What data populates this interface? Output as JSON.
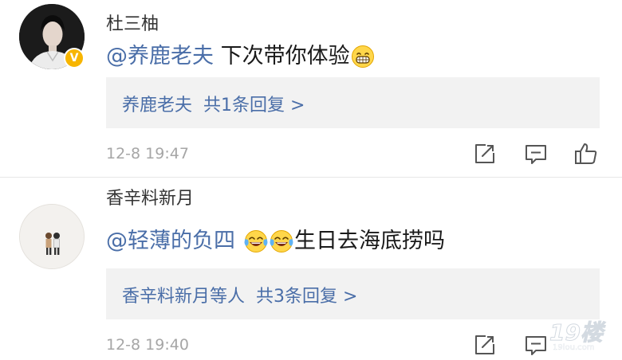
{
  "comments": [
    {
      "username": "杜三柚",
      "verified_badge": "V",
      "mention": "@养鹿老夫",
      "text": " 下次带你体验",
      "emojis": [
        "grinning-face"
      ],
      "reply_user": "养鹿老夫",
      "reply_count_text": "共1条回复 >",
      "time": "12-8 19:47"
    },
    {
      "username": "香辛料新月",
      "mention": "@轻薄的负四",
      "emojis": [
        "tears-of-joy-face",
        "tears-of-joy-face"
      ],
      "text": "生日去海底捞吗",
      "reply_user": "香辛料新月等人",
      "reply_count_text": "共3条回复 >",
      "time": "12-8 19:40"
    }
  ],
  "actions": [
    "share-icon",
    "comment-icon",
    "like-icon"
  ],
  "watermark": {
    "brand": "19楼",
    "domain": "19lou.com"
  },
  "colors": {
    "link": "#4a6ea8",
    "time": "#a6a6a6",
    "reply_bg": "#f2f2f2",
    "badge": "#f7b500"
  }
}
